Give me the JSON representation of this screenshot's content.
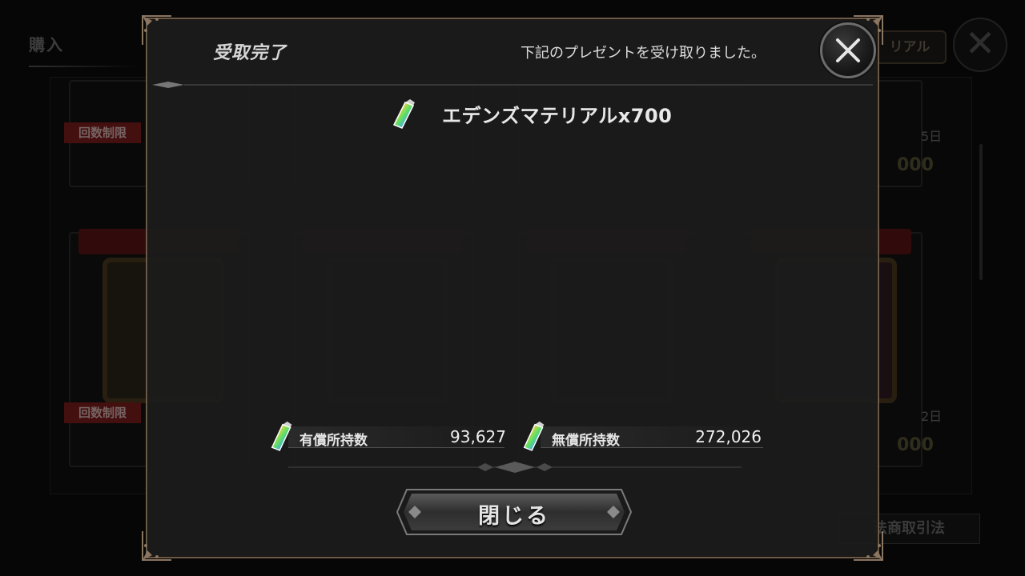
{
  "background": {
    "title": "購入",
    "tab_label": "リアル",
    "close_glyph": "✕",
    "badge_label": "回数制限",
    "days_top_right": "5日",
    "days_bottom_right": "2日",
    "price_top_right": "000",
    "price_bottom_right": "000",
    "law_button_label": "法商取引法"
  },
  "modal": {
    "title": "受取完了",
    "message": "下記のプレゼントを受け取りました。",
    "reward": {
      "icon": "rainbow-crystal-icon",
      "text": "エデンズマテリアルx700"
    },
    "paid": {
      "icon": "rainbow-crystal-icon",
      "label": "有償所持数",
      "value": "93,627"
    },
    "free": {
      "icon": "rainbow-crystal-icon",
      "label": "無償所持数",
      "value": "272,026"
    },
    "close_button_label": "閉じる",
    "close_icon": "close-icon"
  },
  "colors": {
    "frame": "#6b5a48",
    "badge": "#7a1d1d",
    "modal_bg": "#1c1c1c"
  }
}
